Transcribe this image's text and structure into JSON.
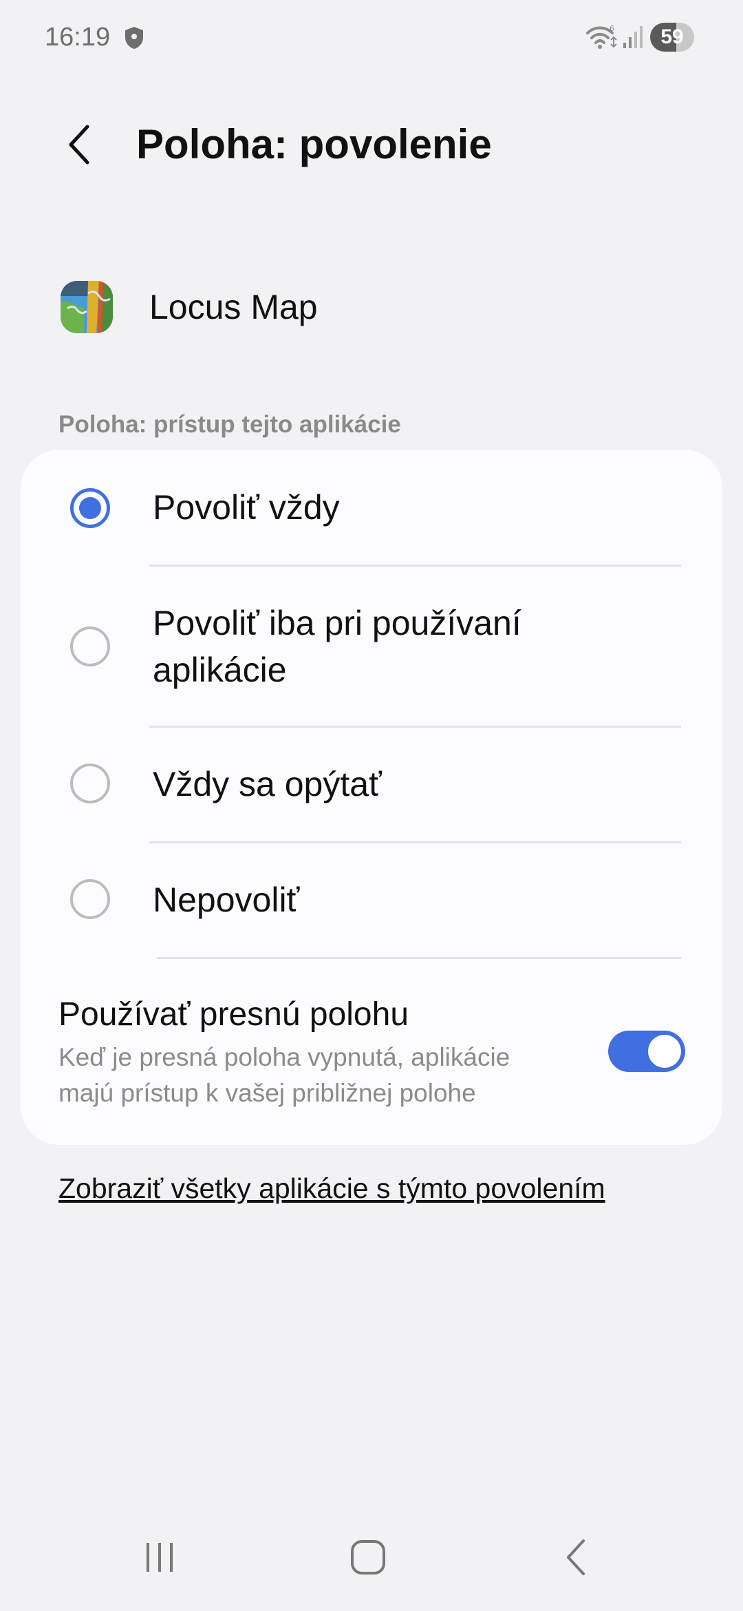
{
  "status_bar": {
    "time": "16:19",
    "battery_percent": "59",
    "battery_level": 0.59
  },
  "header": {
    "title": "Poloha: povolenie"
  },
  "app": {
    "name": "Locus Map"
  },
  "section": {
    "label": "Poloha: prístup tejto aplikácie"
  },
  "options": [
    {
      "label": "Povoliť vždy",
      "selected": true
    },
    {
      "label": "Povoliť iba pri používaní aplikácie",
      "selected": false
    },
    {
      "label": "Vždy sa opýtať",
      "selected": false
    },
    {
      "label": "Nepovoliť",
      "selected": false
    }
  ],
  "precise_location": {
    "title": "Používať presnú polohu",
    "description": "Keď je presná poloha vypnutá, aplikácie majú prístup k vašej približnej polohe",
    "enabled": true
  },
  "footer_link": "Zobraziť všetky aplikácie s týmto povolením",
  "colors": {
    "accent": "#3f6fe0",
    "background": "#f2f2f4",
    "card": "#fcfcfe"
  },
  "icons": {
    "back": "chevron-left-icon",
    "shield": "shield-icon",
    "wifi": "wifi-icon",
    "signal": "signal-icon",
    "battery": "battery-icon",
    "nav_recents": "recents-icon",
    "nav_home": "home-icon",
    "nav_back": "back-icon"
  }
}
